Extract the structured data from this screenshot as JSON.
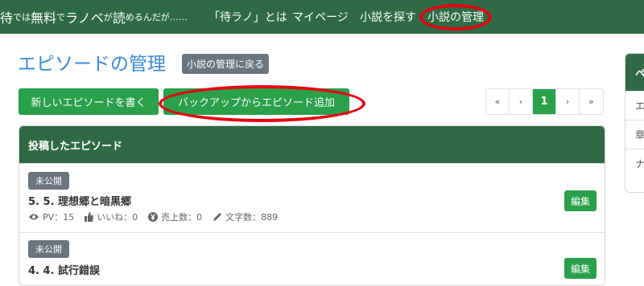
{
  "navbar": {
    "brand_parts": [
      "待",
      "では",
      "無料",
      "で",
      "ラノベ",
      "が",
      "読",
      "めるんだが……"
    ],
    "links": [
      {
        "label": "「待ラノ」とは"
      },
      {
        "label": "マイページ"
      },
      {
        "label": "小説を探す"
      },
      {
        "label": "小説の管理"
      }
    ]
  },
  "page": {
    "title": "エピソードの管理",
    "back_button": "小説の管理に戻る"
  },
  "actions": {
    "new_episode": "新しいエピソードを書く",
    "add_from_backup": "バックアップからエピソード追加"
  },
  "pagination": {
    "first": "«",
    "prev": "‹",
    "current": "1",
    "next": "›",
    "last": "»"
  },
  "episodes_card": {
    "header": "投稿したエピソード",
    "episodes": [
      {
        "status": "未公開",
        "title": "5. 5. 理想郷と暗黒郷",
        "pv_label": "PV：15",
        "likes_label": "いいね：0",
        "sales_label": "売上数：0",
        "chars_label": "文字数：889",
        "edit": "編集"
      },
      {
        "status": "未公開",
        "title": "4. 4. 試行錯誤",
        "edit": "編集"
      }
    ]
  },
  "sidebar": {
    "header": "ペ",
    "items": [
      "エ",
      "章",
      "ナ"
    ]
  },
  "colors": {
    "nav_green": "#2e6b45",
    "button_green": "#2aa04a",
    "title_blue": "#3a8ad6",
    "annotation_red": "#e60012"
  }
}
